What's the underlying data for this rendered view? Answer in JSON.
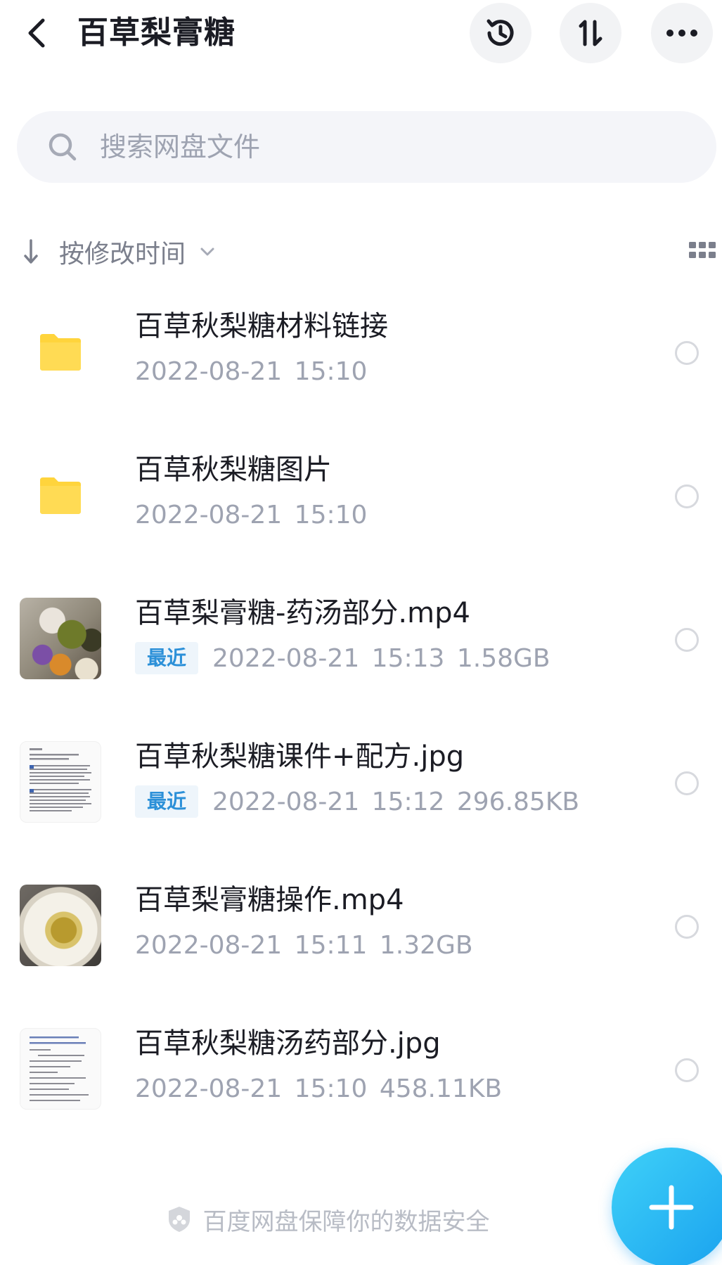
{
  "header": {
    "title": "百草梨膏糖"
  },
  "search": {
    "placeholder": "搜索网盘文件"
  },
  "sort": {
    "label": "按修改时间"
  },
  "files": [
    {
      "name": "百草秋梨糖材料链接",
      "type": "folder",
      "meta": "2022-08-21  15:10",
      "badge": ""
    },
    {
      "name": "百草秋梨糖图片",
      "type": "folder",
      "meta": "2022-08-21  15:10",
      "badge": ""
    },
    {
      "name": "百草梨膏糖-药汤部分.mp4",
      "type": "video",
      "meta": "2022-08-21  15:13  1.58GB",
      "badge": "最近"
    },
    {
      "name": "百草秋梨糖课件+配方.jpg",
      "type": "image",
      "meta": "2022-08-21  15:12  296.85KB",
      "badge": "最近"
    },
    {
      "name": "百草梨膏糖操作.mp4",
      "type": "video",
      "meta": "2022-08-21  15:11  1.32GB",
      "badge": ""
    },
    {
      "name": "百草秋梨糖汤药部分.jpg",
      "type": "image",
      "meta": "2022-08-21  15:10  458.11KB",
      "badge": ""
    }
  ],
  "footer": {
    "text": "百度网盘保障你的数据安全"
  },
  "colors": {
    "accent": "#1aa2ef",
    "folder": "#ffd43c",
    "badge_text": "#2c90d8",
    "muted_text": "#9ea3b1"
  },
  "icons": [
    "back-arrow-icon",
    "history-icon",
    "sort-toggle-icon",
    "more-icon",
    "search-icon",
    "sort-arrow-down-icon",
    "chevron-down-icon",
    "grid-view-icon",
    "folder-icon",
    "shield-icon",
    "plus-icon"
  ]
}
